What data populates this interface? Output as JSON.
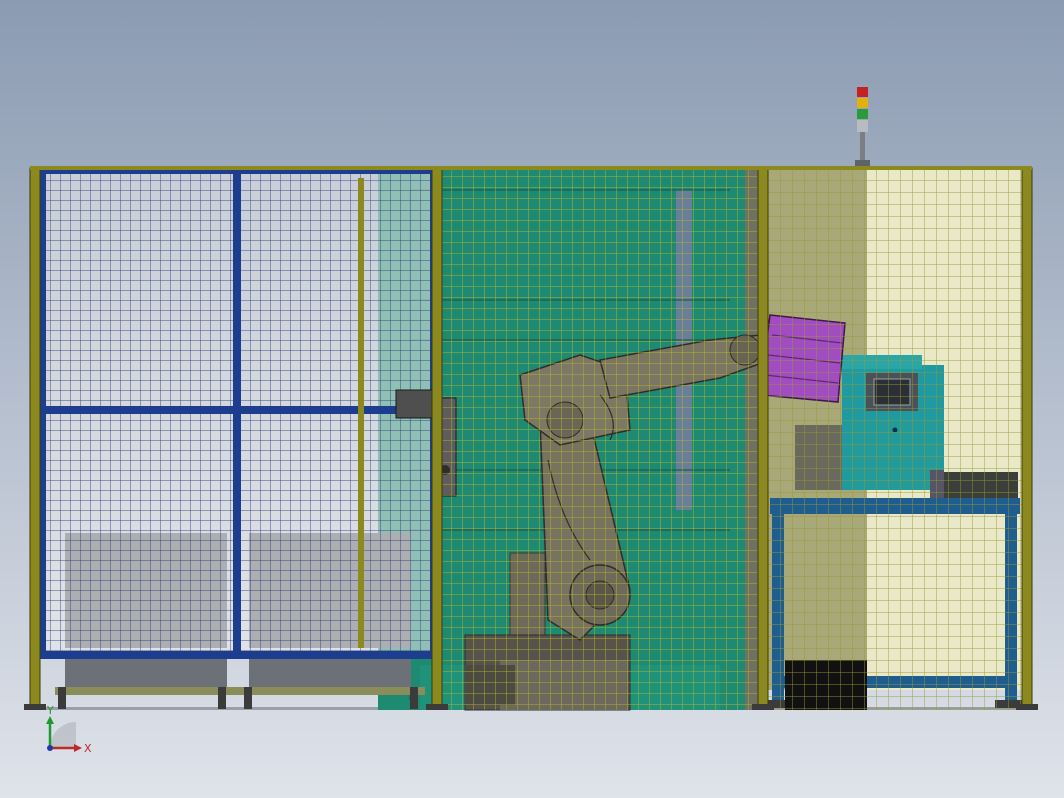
{
  "viewport": {
    "background_top": "#8b9bb2",
    "background_bottom": "#dfe3ea"
  },
  "colors": {
    "fence_post": "#8c8a1e",
    "fence_mesh": "#c9c866",
    "door_frame": "#1d3e8f",
    "machine_green": "#1f8a72",
    "robot_gray": "#6e6a5a",
    "gripper_purple": "#a24cc2",
    "controller_teal": "#1e9aa0",
    "table_blue": "#1f5d8e",
    "steel_dark": "#4a4a4a",
    "bin_gray": "#5d636b"
  },
  "triad": {
    "x_label": "X",
    "y_label": "Y",
    "x_color": "#c0282a",
    "y_color": "#1e9a2e",
    "z_color": "#1f3aa6"
  },
  "stack_light": {
    "segments": [
      "#c42222",
      "#e3b010",
      "#2a9a3a",
      "#b8bcc2"
    ]
  },
  "components": [
    "safety-door",
    "storage-bins",
    "robot-arm",
    "gripper",
    "cnc-machine",
    "controller-unit",
    "work-table",
    "stack-light",
    "safety-fence"
  ]
}
